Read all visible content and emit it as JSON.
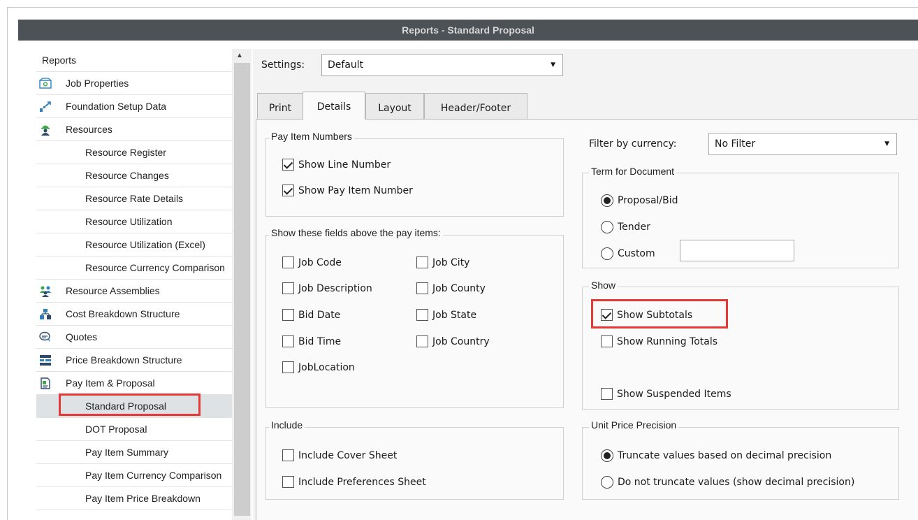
{
  "window": {
    "title": "Reports - Standard Proposal"
  },
  "tree": {
    "items": [
      {
        "label": "Reports",
        "level": 0,
        "icon": "none"
      },
      {
        "label": "Job Properties",
        "level": 1,
        "icon": "job-properties-icon"
      },
      {
        "label": "Foundation Setup Data",
        "level": 1,
        "icon": "foundation-icon"
      },
      {
        "label": "Resources",
        "level": 1,
        "icon": "resources-icon"
      },
      {
        "label": "Resource Register",
        "level": 2
      },
      {
        "label": "Resource Changes",
        "level": 2
      },
      {
        "label": "Resource Rate Details",
        "level": 2
      },
      {
        "label": "Resource Utilization",
        "level": 2
      },
      {
        "label": "Resource Utilization (Excel)",
        "level": 2
      },
      {
        "label": "Resource Currency Comparison",
        "level": 2
      },
      {
        "label": "Resource Assemblies",
        "level": 1,
        "icon": "assemblies-icon"
      },
      {
        "label": "Cost Breakdown Structure",
        "level": 1,
        "icon": "cost-breakdown-icon"
      },
      {
        "label": "Quotes",
        "level": 1,
        "icon": "quotes-icon"
      },
      {
        "label": "Price Breakdown Structure",
        "level": 1,
        "icon": "price-breakdown-icon"
      },
      {
        "label": "Pay Item & Proposal",
        "level": 1,
        "icon": "pay-item-icon"
      },
      {
        "label": "Standard Proposal",
        "level": 2,
        "selected": true
      },
      {
        "label": "DOT Proposal",
        "level": 2
      },
      {
        "label": "Pay Item Summary",
        "level": 2
      },
      {
        "label": "Pay Item Currency Comparison",
        "level": 2
      },
      {
        "label": "Pay Item Price Breakdown",
        "level": 2
      }
    ]
  },
  "settings": {
    "label": "Settings:",
    "value": "Default"
  },
  "tabs": [
    {
      "label": "Print",
      "active": false
    },
    {
      "label": "Details",
      "active": true
    },
    {
      "label": "Layout",
      "active": false
    },
    {
      "label": "Header/Footer",
      "active": false
    }
  ],
  "pay_item_numbers": {
    "title": "Pay Item Numbers",
    "options": [
      {
        "label": "Show Line Number",
        "checked": true
      },
      {
        "label": "Show Pay Item Number",
        "checked": true
      }
    ]
  },
  "fields_above": {
    "title": "Show these fields above the pay items:",
    "options": [
      {
        "label": "Job Code",
        "checked": false
      },
      {
        "label": "Job City",
        "checked": false
      },
      {
        "label": "Job Description",
        "checked": false
      },
      {
        "label": "Job County",
        "checked": false
      },
      {
        "label": "Bid Date",
        "checked": false
      },
      {
        "label": "Job State",
        "checked": false
      },
      {
        "label": "Bid Time",
        "checked": false
      },
      {
        "label": "Job Country",
        "checked": false
      },
      {
        "label": "JobLocation",
        "checked": false
      }
    ]
  },
  "include": {
    "title": "Include",
    "options": [
      {
        "label": "Include Cover Sheet",
        "checked": false
      },
      {
        "label": "Include Preferences Sheet",
        "checked": false
      }
    ]
  },
  "filter_currency": {
    "label": "Filter by currency:",
    "value": "No Filter"
  },
  "term_for_document": {
    "title": "Term for Document",
    "options": [
      {
        "label": "Proposal/Bid",
        "selected": true
      },
      {
        "label": "Tender",
        "selected": false
      },
      {
        "label": "Custom",
        "selected": false
      }
    ],
    "custom_value": ""
  },
  "show": {
    "title": "Show",
    "options": [
      {
        "label": "Show Subtotals",
        "checked": true
      },
      {
        "label": "Show Running Totals",
        "checked": false
      },
      {
        "label": "Show Suspended Items",
        "checked": false
      }
    ]
  },
  "unit_price_precision": {
    "title": "Unit Price Precision",
    "options": [
      {
        "label": "Truncate values based on decimal precision",
        "selected": true
      },
      {
        "label": "Do not truncate values (show decimal precision)",
        "selected": false
      }
    ]
  },
  "colors": {
    "titlebar": "#4d5256",
    "highlight": "#e53935",
    "selection": "#dfe2e5"
  }
}
